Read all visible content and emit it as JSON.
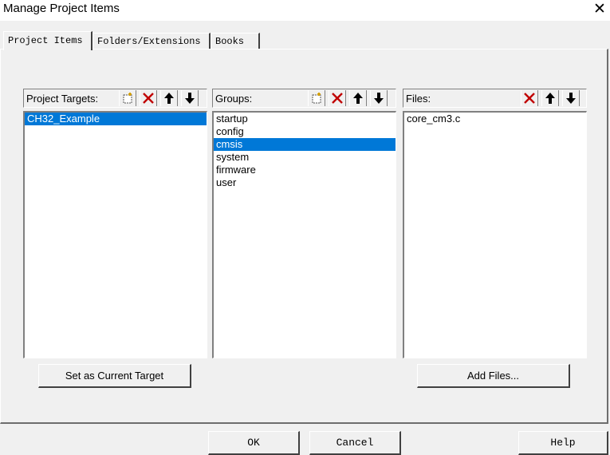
{
  "window": {
    "title": "Manage Project Items"
  },
  "tabs": [
    {
      "label": "Project Items",
      "active": true
    },
    {
      "label": "Folders/Extensions",
      "active": false
    },
    {
      "label": "Books",
      "active": false
    }
  ],
  "targets": {
    "label": "Project Targets:",
    "items": [
      "CH32_Example"
    ],
    "selected_index": 0,
    "toolbar": [
      "new-icon",
      "delete-icon",
      "move-up-icon",
      "move-down-icon"
    ]
  },
  "groups": {
    "label": "Groups:",
    "items": [
      "startup",
      "config",
      "cmsis",
      "system",
      "firmware",
      "user"
    ],
    "selected_index": 2,
    "toolbar": [
      "new-icon",
      "delete-icon",
      "move-up-icon",
      "move-down-icon"
    ]
  },
  "files": {
    "label": "Files:",
    "items": [
      "core_cm3.c"
    ],
    "toolbar": [
      "delete-icon",
      "move-up-icon",
      "move-down-icon"
    ]
  },
  "buttons": {
    "set_current_target": "Set as Current Target",
    "add_files": "Add Files...",
    "ok": "OK",
    "cancel": "Cancel",
    "help": "Help"
  },
  "colors": {
    "selection": "#0078d7",
    "delete_red": "#c00000"
  }
}
